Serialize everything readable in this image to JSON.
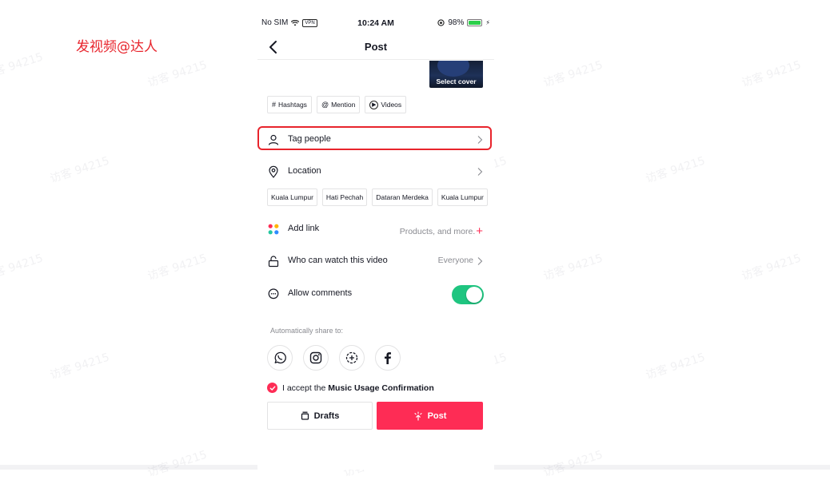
{
  "slide_title": "发视频@达人",
  "watermark": "访客 94215",
  "status_bar": {
    "carrier": "No SIM",
    "vpn": "VPN",
    "time": "10:24 AM",
    "battery": "98%"
  },
  "header": {
    "title": "Post",
    "back_icon": "chevron-left-icon"
  },
  "cover": {
    "label": "Select cover"
  },
  "chips": [
    {
      "icon": "#",
      "label": "Hashtags"
    },
    {
      "icon": "@",
      "label": "Mention"
    },
    {
      "icon": "▶",
      "label": "Videos"
    }
  ],
  "tag_people": {
    "label": "Tag people",
    "icon": "person-icon",
    "highlight_color": "#e8242c"
  },
  "location": {
    "label": "Location",
    "icon": "location-pin-icon",
    "suggestions": [
      "Kuala Lumpur",
      "Hati Pechah",
      "Dataran Merdeka",
      "Kuala Lumpur"
    ]
  },
  "add_link": {
    "label": "Add link",
    "value": "Products, and more.",
    "action": "+"
  },
  "who_can_watch": {
    "label": "Who can watch this video",
    "value": "Everyone"
  },
  "allow_comments": {
    "label": "Allow comments",
    "enabled": true
  },
  "share": {
    "label": "Automatically share to:",
    "targets": [
      "whatsapp-icon",
      "instagram-icon",
      "add-story-icon",
      "facebook-icon"
    ]
  },
  "accept": {
    "prefix": "I accept the",
    "link": "Music Usage Confirmation",
    "checked": true
  },
  "buttons": {
    "drafts": "Drafts",
    "post": "Post"
  },
  "colors": {
    "accent": "#fe2c55",
    "toggle_on": "#1fc580",
    "annotation_red": "#e8242c"
  }
}
